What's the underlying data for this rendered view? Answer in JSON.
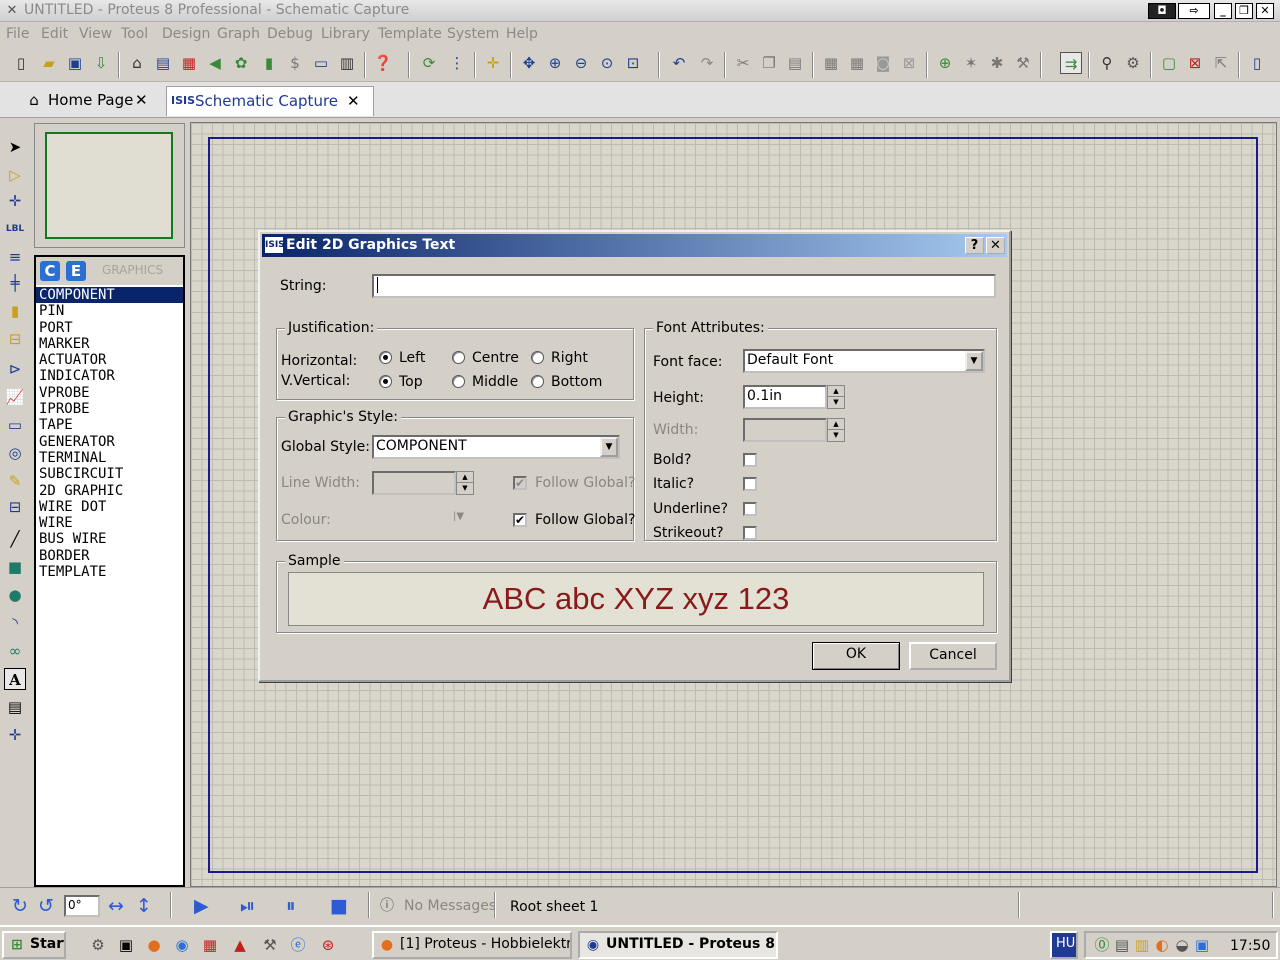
{
  "window": {
    "title": "UNTITLED - Proteus 8 Professional - Schematic Capture",
    "controls": [
      "min",
      "max",
      "close"
    ]
  },
  "menu": [
    "File",
    "Edit",
    "View",
    "Tool",
    "Design",
    "Graph",
    "Debug",
    "Library",
    "Template",
    "System",
    "Help"
  ],
  "tabs": [
    {
      "label": "Home Page",
      "icon": "home-icon",
      "active": false
    },
    {
      "label": "Schematic Capture",
      "icon": "isis-icon",
      "active": true
    }
  ],
  "mode_panel": {
    "buttons": [
      "C",
      "E"
    ],
    "header": "GRAPHICS",
    "items": [
      "COMPONENT",
      "PIN",
      "PORT",
      "MARKER",
      "ACTUATOR",
      "INDICATOR",
      "VPROBE",
      "IPROBE",
      "TAPE",
      "GENERATOR",
      "TERMINAL",
      "SUBCIRCUIT",
      "2D GRAPHIC",
      "WIRE DOT",
      "WIRE",
      "BUS WIRE",
      "BORDER",
      "TEMPLATE"
    ],
    "selected": "COMPONENT"
  },
  "dialog": {
    "title": "Edit 2D Graphics Text",
    "help_button": "?",
    "close_button": "X",
    "string_label": "String:",
    "string_value": "",
    "justification": {
      "title": "Justification:",
      "horizontal_label": "Horizontal:",
      "vertical_label": "V.Vertical:",
      "h_options": [
        "Left",
        "Centre",
        "Right"
      ],
      "h_selected": "Left",
      "v_options": [
        "Top",
        "Middle",
        "Bottom"
      ],
      "v_selected": "Top"
    },
    "graphics_style": {
      "title": "Graphic's Style:",
      "global_style_label": "Global Style:",
      "global_style_value": "COMPONENT",
      "line_width_label": "Line Width:",
      "line_width_value": "",
      "follow_global_1": "Follow Global?",
      "follow_global_1_checked": true,
      "colour_label": "Colour:",
      "follow_global_2": "Follow Global?",
      "follow_global_2_checked": true
    },
    "font_attributes": {
      "title": "Font Attributes:",
      "font_face_label": "Font face:",
      "font_face_value": "Default Font",
      "height_label": "Height:",
      "height_value": "0.1in",
      "width_label": "Width:",
      "width_value": "",
      "bold_label": "Bold?",
      "italic_label": "Italic?",
      "underline_label": "Underline?",
      "strikeout_label": "Strikeout?"
    },
    "sample": {
      "title": "Sample",
      "text": "ABC abc XYZ xyz 123",
      "color": "#8a1a1a"
    },
    "ok_label": "OK",
    "cancel_label": "Cancel"
  },
  "status": {
    "rotation": "0°",
    "messages": "No Messages",
    "sheet": "Root sheet 1"
  },
  "taskbar": {
    "start": "Start",
    "tasks": [
      "[1] Proteus - Hobbielektr...",
      "UNTITLED - Proteus 8 ..."
    ],
    "language": "HU",
    "clock": "17:50"
  }
}
